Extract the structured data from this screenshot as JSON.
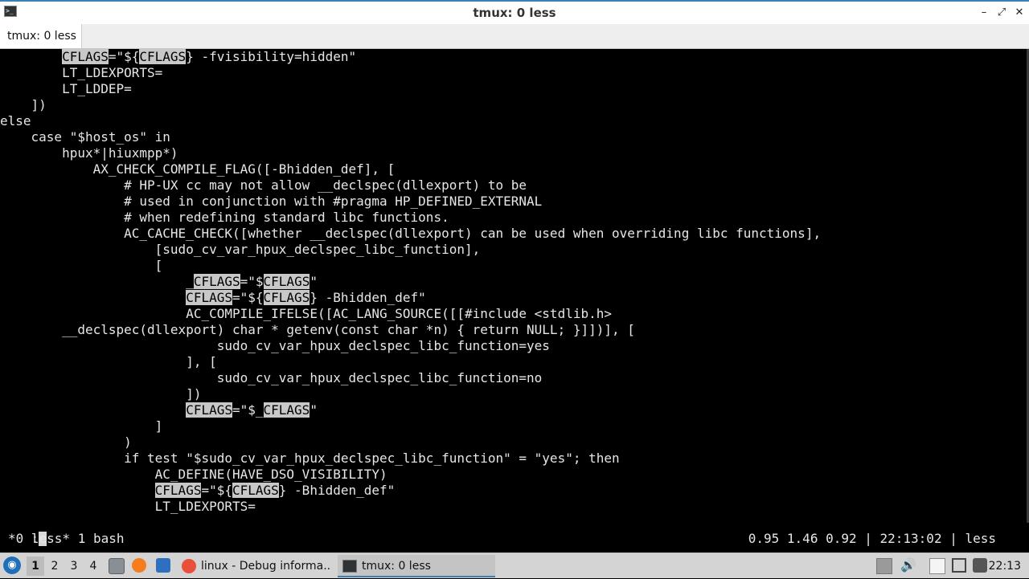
{
  "window": {
    "title": "tmux: 0 less",
    "app_icon": ">_",
    "minimize_icon": "–",
    "maximize_icon": "⤢",
    "close_icon": "✕"
  },
  "tabs": [
    {
      "label": "tmux: 0 less"
    }
  ],
  "terminal": {
    "lines": [
      [
        {
          "t": "        "
        },
        {
          "t": "CFLAGS",
          "hl": true
        },
        {
          "t": "=\"${"
        },
        {
          "t": "CFLAGS",
          "hl": true
        },
        {
          "t": "} -fvisibility=hidden\""
        }
      ],
      [
        {
          "t": "        LT_LDEXPORTS="
        }
      ],
      [
        {
          "t": "        LT_LDDEP="
        }
      ],
      [
        {
          "t": "    ])"
        }
      ],
      [
        {
          "t": "else"
        }
      ],
      [
        {
          "t": "    case \"$host_os\" in"
        }
      ],
      [
        {
          "t": "        hpux*|hiuxmpp*)"
        }
      ],
      [
        {
          "t": "            AX_CHECK_COMPILE_FLAG([-Bhidden_def], ["
        }
      ],
      [
        {
          "t": "                # HP-UX cc may not allow __declspec(dllexport) to be"
        }
      ],
      [
        {
          "t": "                # used in conjunction with #pragma HP_DEFINED_EXTERNAL"
        }
      ],
      [
        {
          "t": "                # when redefining standard libc functions."
        }
      ],
      [
        {
          "t": "                AC_CACHE_CHECK([whether __declspec(dllexport) can be used when overriding libc functions],"
        }
      ],
      [
        {
          "t": "                    [sudo_cv_var_hpux_declspec_libc_function],"
        }
      ],
      [
        {
          "t": "                    ["
        }
      ],
      [
        {
          "t": "                        _"
        },
        {
          "t": "CFLAGS",
          "hl": true
        },
        {
          "t": "=\"$"
        },
        {
          "t": "CFLAGS",
          "hl": true
        },
        {
          "t": "\""
        }
      ],
      [
        {
          "t": "                        "
        },
        {
          "t": "CFLAGS",
          "hl": true
        },
        {
          "t": "=\"${"
        },
        {
          "t": "CFLAGS",
          "hl": true
        },
        {
          "t": "} -Bhidden_def\""
        }
      ],
      [
        {
          "t": "                        AC_COMPILE_IFELSE([AC_LANG_SOURCE([[#include <stdlib.h>"
        }
      ],
      [
        {
          "t": "        __declspec(dllexport) char * getenv(const char *n) { return NULL; }]])], ["
        }
      ],
      [
        {
          "t": "                            sudo_cv_var_hpux_declspec_libc_function=yes"
        }
      ],
      [
        {
          "t": "                        ], ["
        }
      ],
      [
        {
          "t": "                            sudo_cv_var_hpux_declspec_libc_function=no"
        }
      ],
      [
        {
          "t": "                        ])"
        }
      ],
      [
        {
          "t": "                        "
        },
        {
          "t": "CFLAGS",
          "hl": true
        },
        {
          "t": "=\"$_"
        },
        {
          "t": "CFLAGS",
          "hl": true
        },
        {
          "t": "\""
        }
      ],
      [
        {
          "t": "                    ]"
        }
      ],
      [
        {
          "t": "                )"
        }
      ],
      [
        {
          "t": "                if test \"$sudo_cv_var_hpux_declspec_libc_function\" = \"yes\"; then"
        }
      ],
      [
        {
          "t": "                    AC_DEFINE(HAVE_DSO_VISIBILITY)"
        }
      ],
      [
        {
          "t": "                    "
        },
        {
          "t": "CFLAGS",
          "hl": true
        },
        {
          "t": "=\"${"
        },
        {
          "t": "CFLAGS",
          "hl": true
        },
        {
          "t": "} -Bhidden_def\""
        }
      ],
      [
        {
          "t": "                    LT_LDEXPORTS="
        }
      ]
    ],
    "prompt": ":",
    "status_left": "*0 less* 1 bash",
    "status_right": "0.95 1.46 0.92 | 22:13:02 | less",
    "highlight_color": "#c8c8c8"
  },
  "panel": {
    "start_icon": "menu-icon",
    "start_glyph": "◉",
    "workspaces": [
      "1",
      "2",
      "3",
      "4"
    ],
    "active_workspace": "1",
    "launchers": [
      "file-manager-icon",
      "firefox-icon",
      "desktop-icon"
    ],
    "tasks": [
      {
        "label": "linux - Debug informa...",
        "icon": "firefox-icon",
        "active": false
      },
      {
        "label": "tmux: 0 less",
        "icon": "terminal-icon",
        "active": true
      }
    ],
    "tray_icons": [
      "notes-icon",
      "volume-icon",
      "clipboard-icon",
      "network-icon",
      "power-icon"
    ],
    "clock": "22:13"
  }
}
